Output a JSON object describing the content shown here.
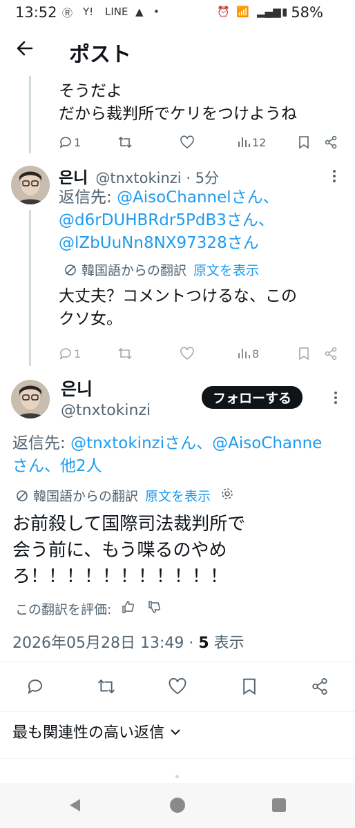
{
  "status_bar": {
    "time": "13:52",
    "battery": "58%"
  },
  "header": {
    "title": "ポスト"
  },
  "tweet1": {
    "line1": "そうだよ",
    "line2": "だから裁判所でケリをつけようね",
    "replies": "1",
    "views": "12"
  },
  "tweet2": {
    "name": "은니",
    "handle_time": "@tnxtokinzi · 5分",
    "reply_to_label": "返信先: ",
    "reply_user1": "@AisoChannelさん、",
    "reply_user2": "@d6rDUHBRdr5PdB3さん、",
    "reply_user3": "@lZbUuNn8NX97328さん",
    "translation_note": "韓国語からの翻訳",
    "show_original": "原文を表示",
    "body_line1": "大丈夫？コメントつけるな、この",
    "body_line2": "クソ女。",
    "replies": "1",
    "views": "8"
  },
  "main_tweet": {
    "name": "은니",
    "handle": "@tnxtokinzi",
    "follow_label": "フォローする",
    "reply_to_label": "返信先: ",
    "reply_users_line1": "@tnxtokinziさん、@AisoChanne",
    "reply_users_line2": "さん、他2人",
    "translation_note": "韓国語からの翻訳",
    "show_original": "原文を表示",
    "body_line1": "お前殺して国際司法裁判所で",
    "body_line2": "会う前に、もう喋るのやめ",
    "body_line3": "ろ！！！！！！！！！！！",
    "rate_translation": "この翻訳を評価:",
    "date": "2026年05月28日 13:49 · ",
    "view_count": "5",
    "view_label": " 表示"
  },
  "relevant_replies": {
    "label": "最も関連性の高い返信"
  },
  "icons": [
    "back-arrow-icon",
    "reply-icon",
    "retweet-icon",
    "like-icon",
    "views-icon",
    "bookmark-icon",
    "share-icon",
    "more-icon",
    "translate-icon",
    "gear-icon",
    "thumbs-up-icon",
    "thumbs-down-icon",
    "chevron-down-icon",
    "nav-back-icon",
    "nav-home-icon",
    "nav-recents-icon"
  ],
  "colors": {
    "link": "#1d9bf0",
    "muted": "#536471",
    "text": "#0f1419",
    "follow_bg": "#0f1419"
  }
}
